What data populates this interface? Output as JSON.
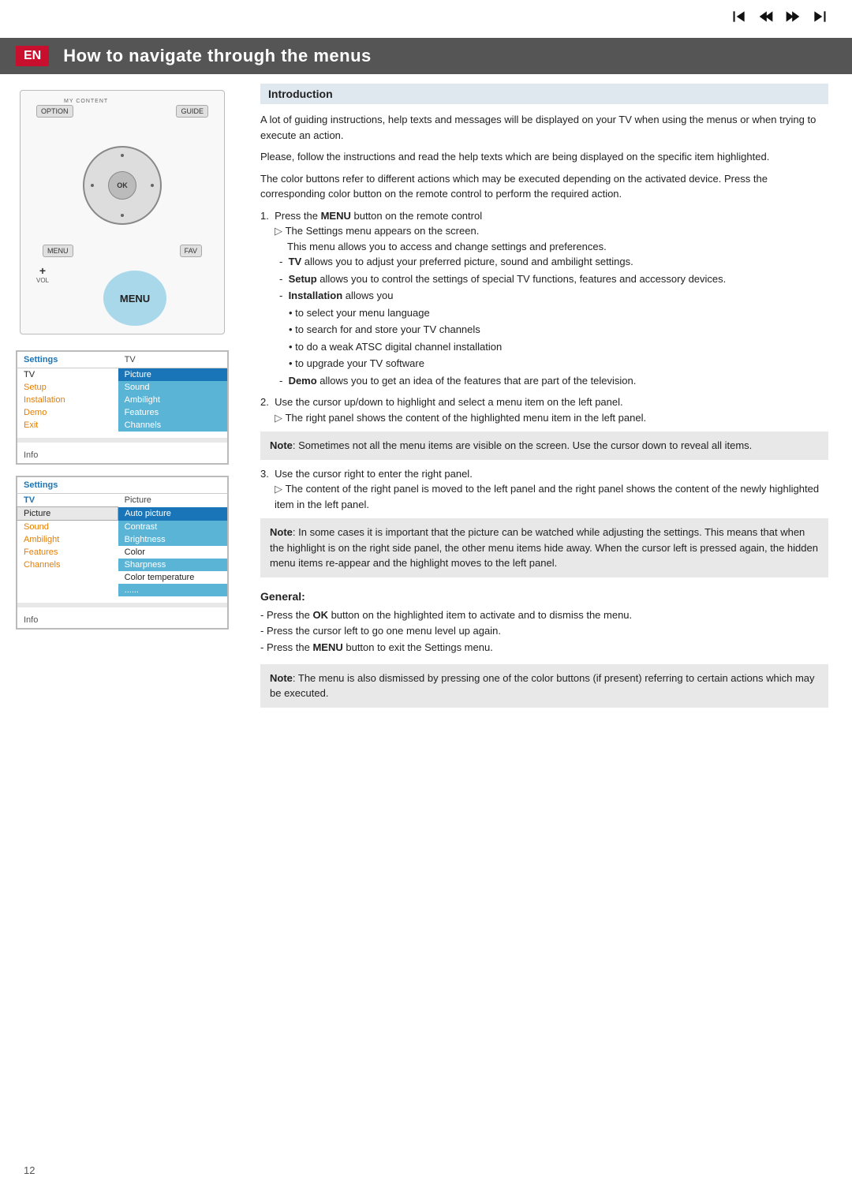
{
  "topnav": {
    "icons": [
      "skip-back",
      "rewind",
      "fast-forward",
      "skip-forward"
    ]
  },
  "header": {
    "en_label": "EN",
    "title": "How to navigate through the menus"
  },
  "remote": {
    "mycontent_label": "MY CONTENT",
    "option_label": "OPTION",
    "guide_label": "GUIDE",
    "ok_label": "OK",
    "menu_label": "MENU",
    "fav_label": "FAV",
    "vol_plus": "+",
    "vol_label": "VOL",
    "menu_bubble": "MENU"
  },
  "settings_table1": {
    "header_left": "Settings",
    "header_right": "TV",
    "rows": [
      {
        "left": "TV",
        "left_style": "white",
        "right": "Picture",
        "right_style": "highlighted"
      },
      {
        "left": "Setup",
        "left_style": "orange",
        "right": "Sound",
        "right_style": "normal"
      },
      {
        "left": "Installation",
        "left_style": "orange",
        "right": "Ambilight",
        "right_style": "normal"
      },
      {
        "left": "Demo",
        "left_style": "orange",
        "right": "Features",
        "right_style": "normal"
      },
      {
        "left": "Exit",
        "left_style": "orange",
        "right": "Channels",
        "right_style": "normal"
      }
    ],
    "info_label": "Info"
  },
  "settings_table2": {
    "header_left": "Settings",
    "header_left2": "TV",
    "header_right": "Picture",
    "rows_left": [
      "Picture",
      "Sound",
      "Ambilight",
      "Features",
      "Channels"
    ],
    "rows_left_styles": [
      "selected",
      "orange",
      "orange",
      "orange",
      "orange"
    ],
    "rows_right": [
      "Auto picture",
      "Contrast",
      "Brightness",
      "Color",
      "Sharpness",
      "Color temperature",
      "......"
    ],
    "rows_right_styles": [
      "highlighted",
      "normal",
      "normal",
      "plain",
      "normal",
      "plain",
      "plain"
    ],
    "info_label": "Info"
  },
  "introduction": {
    "title": "Introduction",
    "paragraphs": [
      "A lot of guiding instructions, help texts and messages will be displayed on your TV when using the menus or when trying to execute an action.",
      "Please, follow the instructions and read the help texts which are being displayed on the specific item highlighted.",
      "The color buttons refer to different actions which may be executed depending on the activated device. Press the corresponding color button on the remote control to perform the required action."
    ]
  },
  "steps": [
    {
      "num": "1.",
      "text": "Press the ",
      "bold": "MENU",
      "text2": " button on the remote control",
      "arrow": "The Settings menu appears on the screen.",
      "indent": "This menu allows you to access and change settings and preferences.",
      "items": [
        {
          "dash": "- ",
          "bold": "TV",
          "text": " allows you to adjust your preferred picture, sound and ambilight settings."
        },
        {
          "dash": "- ",
          "bold": "Setup",
          "text": " allows you to control the settings of special TV functions, features and accessory devices."
        },
        {
          "dash": "- ",
          "bold": "Installation",
          "text": " allows you"
        },
        {
          "bullets": [
            "• to select your menu language",
            "• to search for and store your TV channels",
            "• to do a weak ATSC digital channel installation",
            "• to upgrade your TV software"
          ]
        },
        {
          "dash": "- ",
          "bold": "Demo",
          "text": " allows you to get an idea of the features that are part of the television."
        }
      ]
    },
    {
      "num": "2.",
      "text": "Use the cursor up/down to highlight and select a menu item on the left panel.",
      "arrow": "The right panel shows the content of the highlighted menu item in the left panel.",
      "note": "Note: Sometimes not all the menu items are visible on the screen. Use the cursor down to reveal all items."
    },
    {
      "num": "3.",
      "text": "Use the cursor right to enter the right panel.",
      "arrow": "The content of the right panel is moved to the left panel and the right panel shows the content of the newly highlighted item in the left panel.",
      "note": "Note: In some cases it is important that the picture can be watched while adjusting the settings. This means that when the highlight is on the right side panel, the other menu items hide away. When the cursor left is pressed again, the hidden menu items re-appear and the highlight moves to the left panel."
    }
  ],
  "general": {
    "title": "General:",
    "items": [
      "- Press the **OK** button on the highlighted item to activate and to dismiss the menu.",
      "- Press the cursor left to go one menu level up again.",
      "- Press the **MENU** button to exit the Settings menu."
    ],
    "note": "Note: The menu is also dismissed by pressing one of the color buttons (if present) referring to certain actions which may be executed."
  },
  "page_number": "12"
}
